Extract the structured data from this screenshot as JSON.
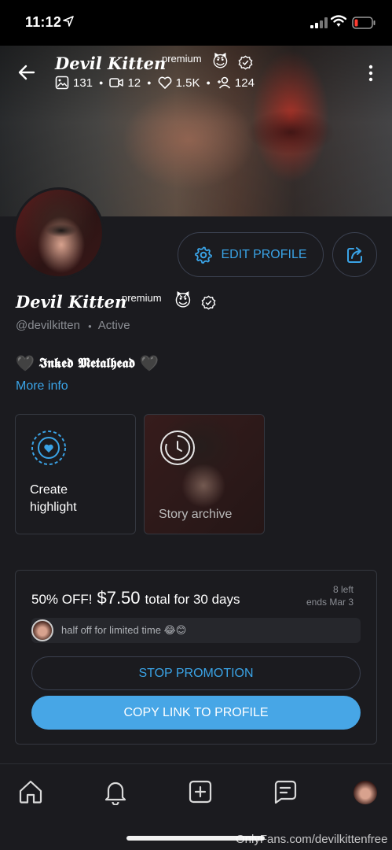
{
  "status_bar": {
    "time": "11:12"
  },
  "header": {
    "name": "Devil Kitten",
    "premium_label": "premium",
    "emoji": "😈",
    "stats": [
      {
        "icon": "photo-icon",
        "value": "131"
      },
      {
        "icon": "video-icon",
        "value": "12"
      },
      {
        "icon": "heart-icon",
        "value": "1.5K"
      },
      {
        "icon": "fans-icon",
        "value": "124"
      }
    ]
  },
  "profile": {
    "name": "Devil Kitten",
    "premium_label": "premium",
    "emoji": "😈",
    "handle": "@devilkitten",
    "status": "Active",
    "edit_label": "EDIT PROFILE",
    "bio": "𝕴𝖓𝖐𝖊𝖉 𝕸𝖊𝖙𝖆𝖑𝖍𝖊𝖆𝖉",
    "bio_heart": "🖤",
    "more_info": "More info"
  },
  "highlights": {
    "create": "Create\nhighlight",
    "archive": "Story archive"
  },
  "promotion": {
    "discount": "50% OFF!",
    "price": "$7.50",
    "term": "total for 30 days",
    "left": "8 left",
    "ends": "ends Mar 3",
    "message": "half off for limited time 😂😊",
    "stop_label": "STOP PROMOTION",
    "copy_label": "COPY LINK TO PROFILE"
  },
  "watermark": "OnlyFans.com/devilkittenfree",
  "colors": {
    "accent": "#3aa3e6",
    "background": "#1b1b1f",
    "border": "#34373f"
  }
}
